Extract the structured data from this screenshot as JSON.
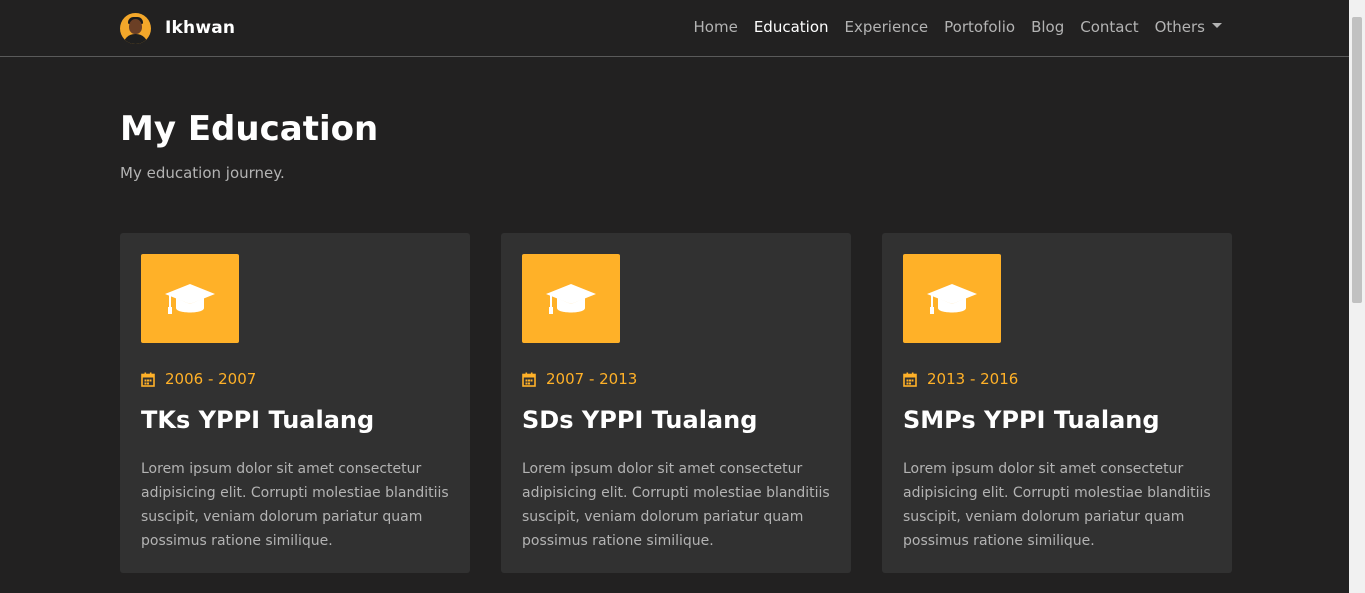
{
  "brand": {
    "name": "Ikhwan"
  },
  "nav": {
    "items": [
      {
        "label": "Home"
      },
      {
        "label": "Education"
      },
      {
        "label": "Experience"
      },
      {
        "label": "Portofolio"
      },
      {
        "label": "Blog"
      },
      {
        "label": "Contact"
      },
      {
        "label": "Others"
      }
    ],
    "active": "Education"
  },
  "header": {
    "title": "My Education",
    "subtitle": "My education journey."
  },
  "education": [
    {
      "icon": "graduation-cap-icon",
      "years": "2006 - 2007",
      "school": "TKs YPPI Tualang",
      "description": "Lorem ipsum dolor sit amet consectetur adipisicing elit. Corrupti molestiae blanditiis suscipit, veniam dolorum pariatur quam possimus ratione similique."
    },
    {
      "icon": "graduation-cap-icon",
      "years": "2007 - 2013",
      "school": "SDs YPPI Tualang",
      "description": "Lorem ipsum dolor sit amet consectetur adipisicing elit. Corrupti molestiae blanditiis suscipit, veniam dolorum pariatur quam possimus ratione similique."
    },
    {
      "icon": "graduation-cap-icon",
      "years": "2013 - 2016",
      "school": "SMPs YPPI Tualang",
      "description": "Lorem ipsum dolor sit amet consectetur adipisicing elit. Corrupti molestiae blanditiis suscipit, veniam dolorum pariatur quam possimus ratione similique."
    }
  ],
  "colors": {
    "background": "#222121",
    "card": "#313131",
    "accent": "#ffb128",
    "muted_text": "#b3b3b3"
  }
}
